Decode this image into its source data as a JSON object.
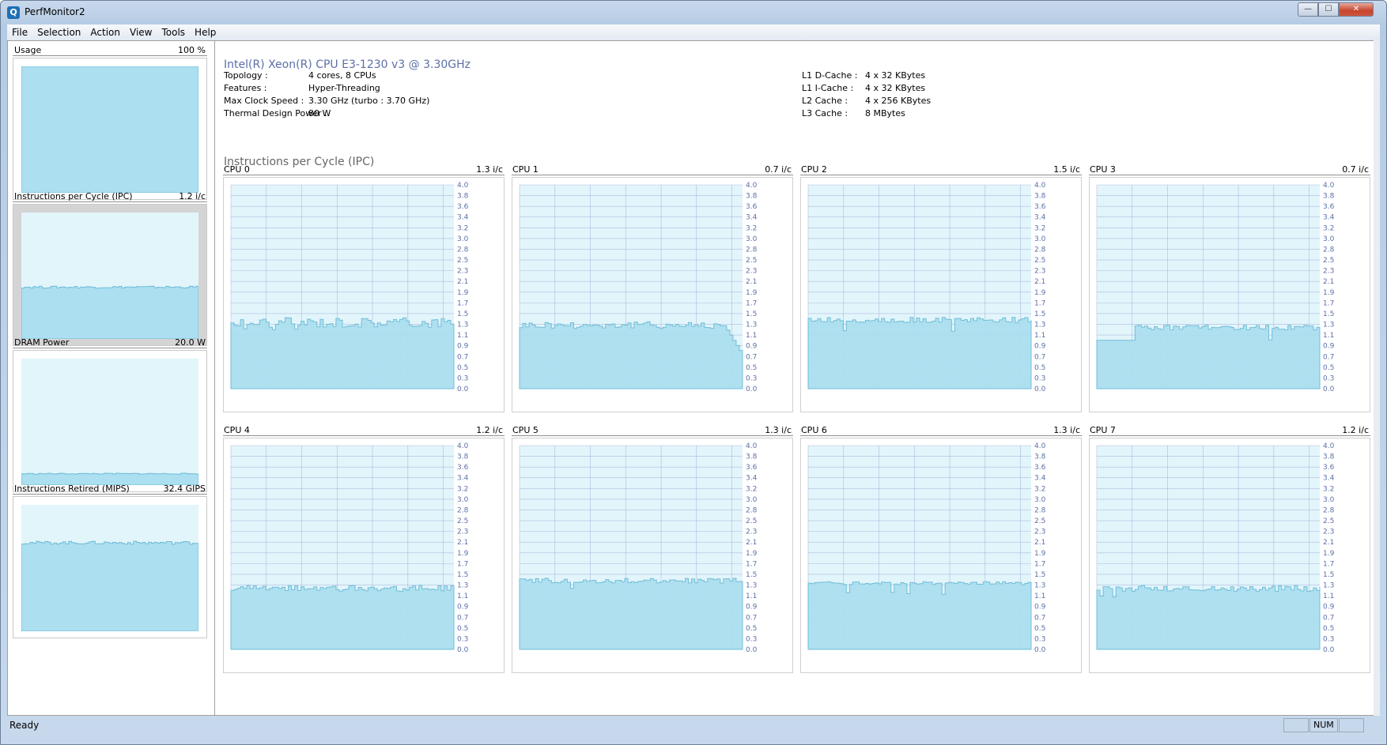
{
  "window": {
    "title": "PerfMonitor2",
    "app_icon_glyph": "Q",
    "min_glyph": "—",
    "max_glyph": "☐",
    "close_glyph": "✕"
  },
  "menu": [
    "File",
    "Selection",
    "Action",
    "View",
    "Tools",
    "Help"
  ],
  "sidebar": [
    {
      "label": "Usage",
      "value": "100 %",
      "level": 1.0,
      "jitter": 0.0,
      "selected": false
    },
    {
      "label": "Instructions per Cycle (IPC)",
      "value": "1.2 i/c",
      "level": 0.41,
      "jitter": 0.008,
      "selected": true
    },
    {
      "label": "DRAM Power",
      "value": "20.0 W",
      "level": 0.09,
      "jitter": 0.004,
      "selected": false
    },
    {
      "label": "Instructions Retired (MIPS)",
      "value": "32.4 GIPS",
      "level": 0.7,
      "jitter": 0.012,
      "selected": false
    }
  ],
  "cpu": {
    "name": "Intel(R) Xeon(R) CPU E3-1230 v3 @ 3.30GHz",
    "left": [
      {
        "label": "Topology :",
        "value": "4 cores, 8 CPUs"
      },
      {
        "label": "Features :",
        "value": "Hyper-Threading"
      },
      {
        "label": "Max Clock Speed :",
        "value": "3.30 GHz (turbo : 3.70 GHz)"
      },
      {
        "label": "Thermal Design Power :",
        "value": "80 W"
      }
    ],
    "right": [
      {
        "label": "L1 D-Cache :",
        "value": "4 x 32 KBytes"
      },
      {
        "label": "L1 I-Cache :",
        "value": "4 x 32 KBytes"
      },
      {
        "label": "L2 Cache :",
        "value": "4 x 256 KBytes"
      },
      {
        "label": "L3 Cache :",
        "value": "8 MBytes"
      }
    ]
  },
  "section_title": "Instructions per Cycle (IPC)",
  "chart_data": {
    "type": "area",
    "y_ticks": [
      "4.0",
      "3.8",
      "3.6",
      "3.4",
      "3.2",
      "3.0",
      "2.8",
      "2.5",
      "2.3",
      "2.1",
      "1.9",
      "1.7",
      "1.5",
      "1.3",
      "1.1",
      "0.9",
      "0.7",
      "0.5",
      "0.3",
      "0.0"
    ],
    "ylim": [
      0,
      4.0
    ],
    "grid": true,
    "series": [
      {
        "name": "CPU 0",
        "value": "1.3 i/c",
        "level": 1.3,
        "jitter": 0.1
      },
      {
        "name": "CPU 1",
        "value": "0.7 i/c",
        "level": 1.25,
        "jitter": 0.07,
        "tail_drop": 0.75
      },
      {
        "name": "CPU 2",
        "value": "1.5 i/c",
        "level": 1.35,
        "jitter": 0.05
      },
      {
        "name": "CPU 3",
        "value": "0.7 i/c",
        "level": 1.2,
        "jitter": 0.05,
        "start_low": 0.95
      },
      {
        "name": "CPU 4",
        "value": "1.2 i/c",
        "level": 1.2,
        "jitter": 0.06
      },
      {
        "name": "CPU 5",
        "value": "1.3 i/c",
        "level": 1.35,
        "jitter": 0.05
      },
      {
        "name": "CPU 6",
        "value": "1.3 i/c",
        "level": 1.3,
        "jitter": 0.03
      },
      {
        "name": "CPU 7",
        "value": "1.2 i/c",
        "level": 1.2,
        "jitter": 0.06
      }
    ]
  },
  "status": {
    "text": "Ready",
    "num": "NUM"
  },
  "colors": {
    "graph_bg": "#e2f5fb",
    "graph_fill": "#acdff0",
    "graph_line": "#6cbcd6",
    "grid_line": "#9aa3d2",
    "accent_text": "#5c6fa8"
  }
}
